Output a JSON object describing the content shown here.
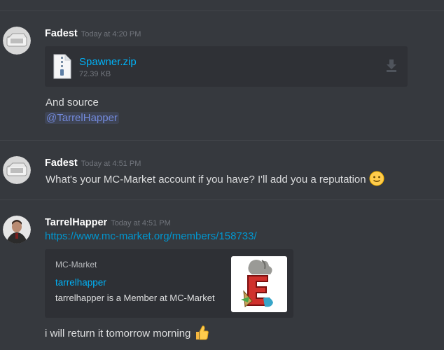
{
  "messages": [
    {
      "username": "Fadest",
      "timestamp": "Today at 4:20 PM",
      "attachment": {
        "filename": "Spawner.zip",
        "size": "72.39 KB",
        "icon": "archive-file-icon"
      },
      "text": "And source",
      "mention": "@TarrelHapper"
    },
    {
      "username": "Fadest",
      "timestamp": "Today at 4:51 PM",
      "text": "What's your MC-Market account if you have? I'll add you a reputation",
      "emoji": "slightly-smiling-face-emoji"
    },
    {
      "username": "TarrelHapper",
      "timestamp": "Today at 4:51 PM",
      "link": "https://www.mc-market.org/members/158733/",
      "embed": {
        "provider": "MC-Market",
        "title": "tarrelhapper",
        "description": "tarrelhapper is a Member at MC-Market"
      },
      "text": "i will return it tomorrow morning",
      "emoji": "thumbs-up-emoji"
    }
  ],
  "colors": {
    "background": "#36393e",
    "username": "#ffffff",
    "timestamp": "#72767d",
    "link": "#0096cf",
    "mention": "#7289da"
  }
}
